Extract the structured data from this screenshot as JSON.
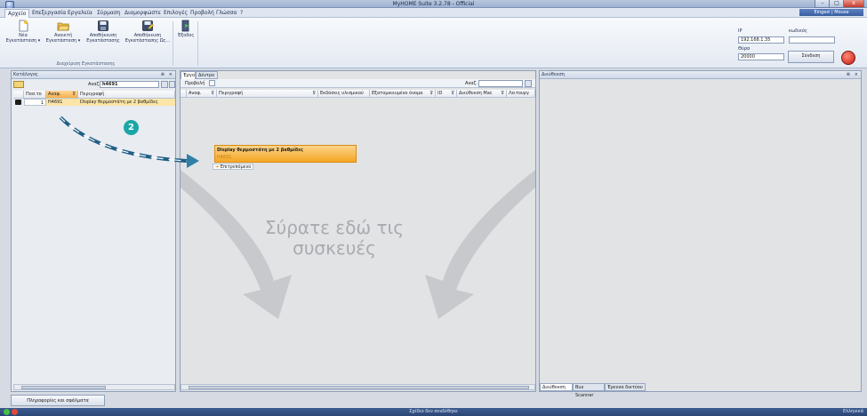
{
  "window": {
    "title": "MyHOME Suite 3.2.78 - Official",
    "minimize_glyph": "–",
    "maximize_glyph": "□",
    "close_glyph": "x",
    "user_label": "Eingezi | Mouse"
  },
  "menu": {
    "tabs": [
      "Αρχείο",
      "Επεξεργασία",
      "Εργαλεία",
      "Σύρμαση",
      "Διαμορφώστε",
      "Επιλογές",
      "Προβολή",
      "Γλώσσα",
      "?"
    ],
    "active_index": 0
  },
  "ribbon": {
    "buttons": [
      {
        "label1": "Νέα",
        "label2": "Εγκατάσταση ▾",
        "icon": "new-document-icon"
      },
      {
        "label1": "Ανοικτή",
        "label2": "Εγκατάσταση ▾",
        "icon": "folder-open-icon"
      },
      {
        "label1": "Αποθήκευση",
        "label2": "Εγκατάστασης",
        "icon": "save-icon"
      },
      {
        "label1": "Αποθήκευση",
        "label2": "Εγκατάστασης Ως...",
        "icon": "save-as-icon"
      }
    ],
    "group_label": "Διαχείριση Εγκατάστασης",
    "exit_label": "Έξοδος",
    "connection": {
      "ip_label": "IP",
      "ip_value": "192.168.1.35",
      "port_label": "Θύρα",
      "port_value": "20000",
      "password_label": "κωδικός",
      "password_value": "",
      "connect_label": "Σύνδεση"
    }
  },
  "catalog": {
    "title": "Κατάλογος",
    "search_label": "Αναζ.",
    "search_value": "h4691",
    "columns": [
      "Ποσ.το",
      "Αναφ.",
      "Περιγραφή"
    ],
    "rows": [
      {
        "qty": "1",
        "ref": "H4691",
        "description": "Display θερμοστάτη με 2 βαθμίδες"
      }
    ]
  },
  "project": {
    "tabs": [
      "Έργο",
      "Δέντρο"
    ],
    "view_label": "Προβολή",
    "search_label": "Αναζ.",
    "columns": [
      "Αναφ.",
      "Περιγραφή",
      "Εκδόσεις υλισμικού",
      "Εξατομικευμένο όνομα",
      "ID",
      "Διεύθυνση Mac",
      "Λειτουργ"
    ],
    "drag_card": {
      "title": "Display θερμοστάτη με 2 βαθμίδες",
      "ref": "H4691",
      "action": "Επιτρεπόμενο"
    },
    "drop_hint": "Σύρατε εδώ τις συσκευές"
  },
  "step_badge": "2",
  "address_panel": {
    "title": "Διεύθυνση",
    "tabs": [
      "Διεύθυνση",
      "Bus Scanner",
      "Έρευνα δικτύου"
    ]
  },
  "bottom": {
    "info_button": "Πληροφορίες και σφάλματα"
  },
  "statusbar": {
    "text": "Σχέδιο δεν συνδέθηκε",
    "language": "Ελληνικά"
  },
  "colors": {
    "highlight_row": "#fbe5a8",
    "drag_card": "#f5a623",
    "badge": "#1aa6a6",
    "arrow": "#2f7fa6"
  }
}
